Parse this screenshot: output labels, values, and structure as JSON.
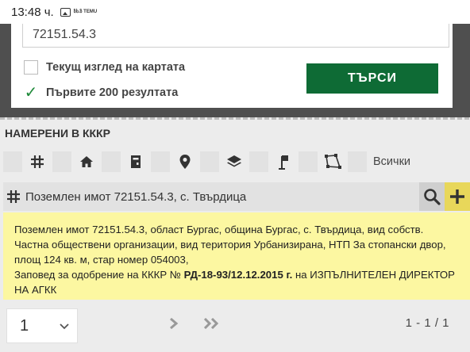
{
  "status_bar": {
    "time": "13:48 ч.",
    "app_badge": "ზხ.ზ TEMU"
  },
  "search": {
    "value": "72151.54.3",
    "options": [
      {
        "label": "Текущ изглед на картата",
        "checked": false,
        "check_glyph": ""
      },
      {
        "label": "Първите 200 резултата",
        "checked": true,
        "check_glyph": "✓"
      }
    ],
    "button_label": "ТЪРСИ"
  },
  "results": {
    "section_title": "НАМЕРЕНИ В КККР",
    "filters": {
      "icons": [
        "grid-icon",
        "home-icon",
        "building-icon",
        "location-pin-icon",
        "layers-icon",
        "flag-icon",
        "polygon-icon"
      ],
      "all_label": "Всички"
    },
    "item": {
      "title": "Поземлен имот 72151.54.3, с. Твърдица",
      "description_plain": "Поземлен имот 72151.54.3, област Бургас, община Бургас, с. Твърдица, вид собств. Частна обществени организации, вид територия Урбанизирана, НТП За стопански двор, площ 124 кв. м, стар номер 054003,",
      "order_prefix": "Заповед за одобрение на КККР №",
      "order_number": "РД-18-93/12.12.2015 г.",
      "order_suffix": "на ИЗПЪЛНИТЕЛЕН ДИРЕКТОР НА АГКК"
    }
  },
  "pagination": {
    "current_page": "1",
    "count": "1 - 1 / 1"
  },
  "colors": {
    "accent_green": "#0e6b35",
    "result_bg": "#fcf7a1",
    "add_button": "#e8d75a"
  }
}
